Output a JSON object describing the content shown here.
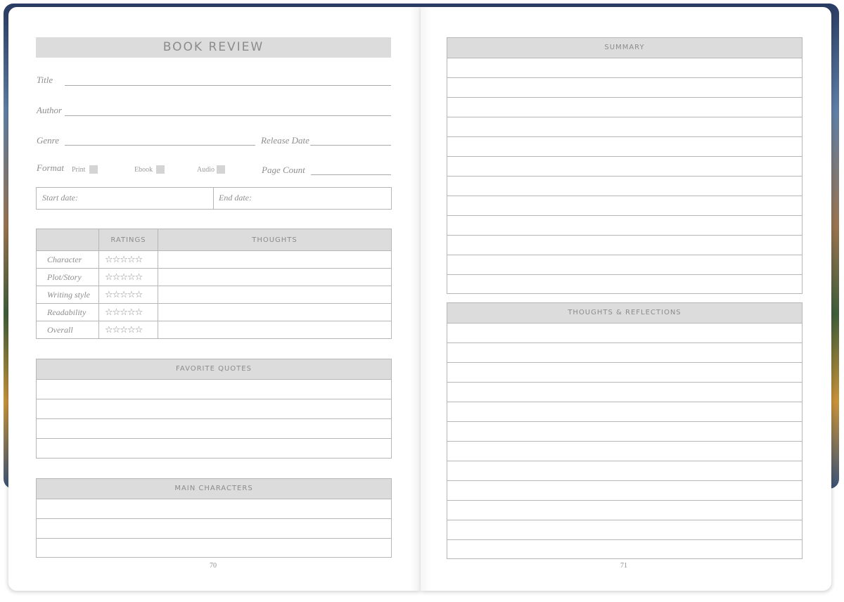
{
  "left_page": {
    "heading": "BOOK REVIEW",
    "fields": {
      "title_label": "Title",
      "author_label": "Author",
      "genre_label": "Genre",
      "release_date_label": "Release Date",
      "format_label": "Format",
      "format_options": [
        "Print",
        "Ebook",
        "Audio"
      ],
      "page_count_label": "Page Count",
      "start_date_label": "Start date:",
      "end_date_label": "End date:"
    },
    "ratings_table": {
      "headers": [
        "",
        "RATINGS",
        "THOUGHTS"
      ],
      "rows": [
        {
          "label": "Character",
          "stars": "☆☆☆☆☆"
        },
        {
          "label": "Plot/Story",
          "stars": "☆☆☆☆☆"
        },
        {
          "label": "Writing style",
          "stars": "☆☆☆☆☆"
        },
        {
          "label": "Readability",
          "stars": "☆☆☆☆☆"
        },
        {
          "label": "Overall",
          "stars": "☆☆☆☆☆"
        }
      ]
    },
    "favorite_quotes": {
      "heading": "FAVORITE QUOTES",
      "lines": 4
    },
    "main_characters": {
      "heading": "MAIN CHARACTERS",
      "lines": 3
    },
    "page_number": "70"
  },
  "right_page": {
    "summary": {
      "heading": "SUMMARY",
      "lines": 12
    },
    "thoughts_reflections": {
      "heading": "THOUGHTS & REFLECTIONS",
      "lines": 12
    },
    "page_number": "71"
  },
  "colors": {
    "header_fill": "#dcdcdd",
    "rule": "#b6b6b8",
    "text_muted": "#8e8e90"
  }
}
